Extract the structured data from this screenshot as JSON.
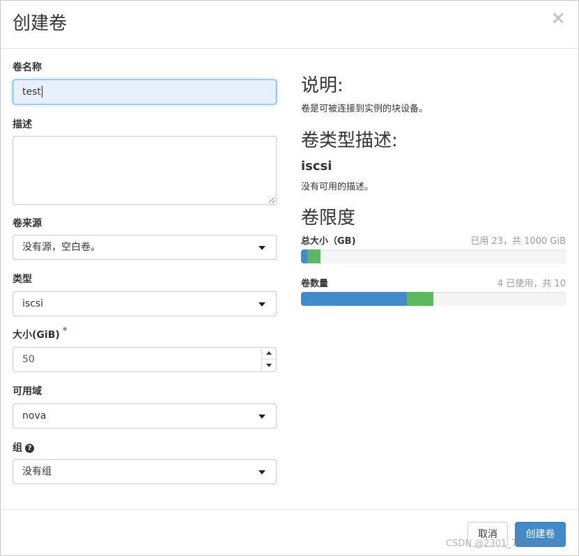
{
  "dialog": {
    "title": "创建卷",
    "close_glyph": "×"
  },
  "form": {
    "name": {
      "label": "卷名称",
      "value": "test"
    },
    "description": {
      "label": "描述",
      "value": ""
    },
    "source": {
      "label": "卷来源",
      "selected": "没有源，空白卷。"
    },
    "type": {
      "label": "类型",
      "selected": "iscsi"
    },
    "size": {
      "label": "大小(GiB)",
      "required_mark": "*",
      "value": "50"
    },
    "availability_zone": {
      "label": "可用域",
      "selected": "nova"
    },
    "group": {
      "label": "组",
      "help_icon": "question-circle",
      "help_glyph": "?",
      "selected": "没有组"
    }
  },
  "info": {
    "description_heading": "说明:",
    "description_text": "卷是可被连接到实例的块设备。",
    "type_heading": "卷类型描述:",
    "type_name": "iscsi",
    "type_text": "没有可用的描述。",
    "limits_heading": "卷限度",
    "quotas": [
      {
        "label": "总大小（GB)",
        "value_text": "已用 23，共 1000 GiB",
        "used_fraction": 0.023,
        "requested_fraction": 0.05
      },
      {
        "label": "卷数量",
        "value_text": "4 已使用，共 10",
        "used_fraction": 0.4,
        "requested_fraction": 0.1
      }
    ]
  },
  "footer": {
    "cancel_label": "取消",
    "submit_label": "创建卷"
  },
  "watermark": "CSDN @2301_78779612",
  "colors": {
    "primary": "#428bca",
    "quota_used": "#428bca",
    "quota_requested": "#5cb85c",
    "required_mark": "#3a87c8"
  }
}
